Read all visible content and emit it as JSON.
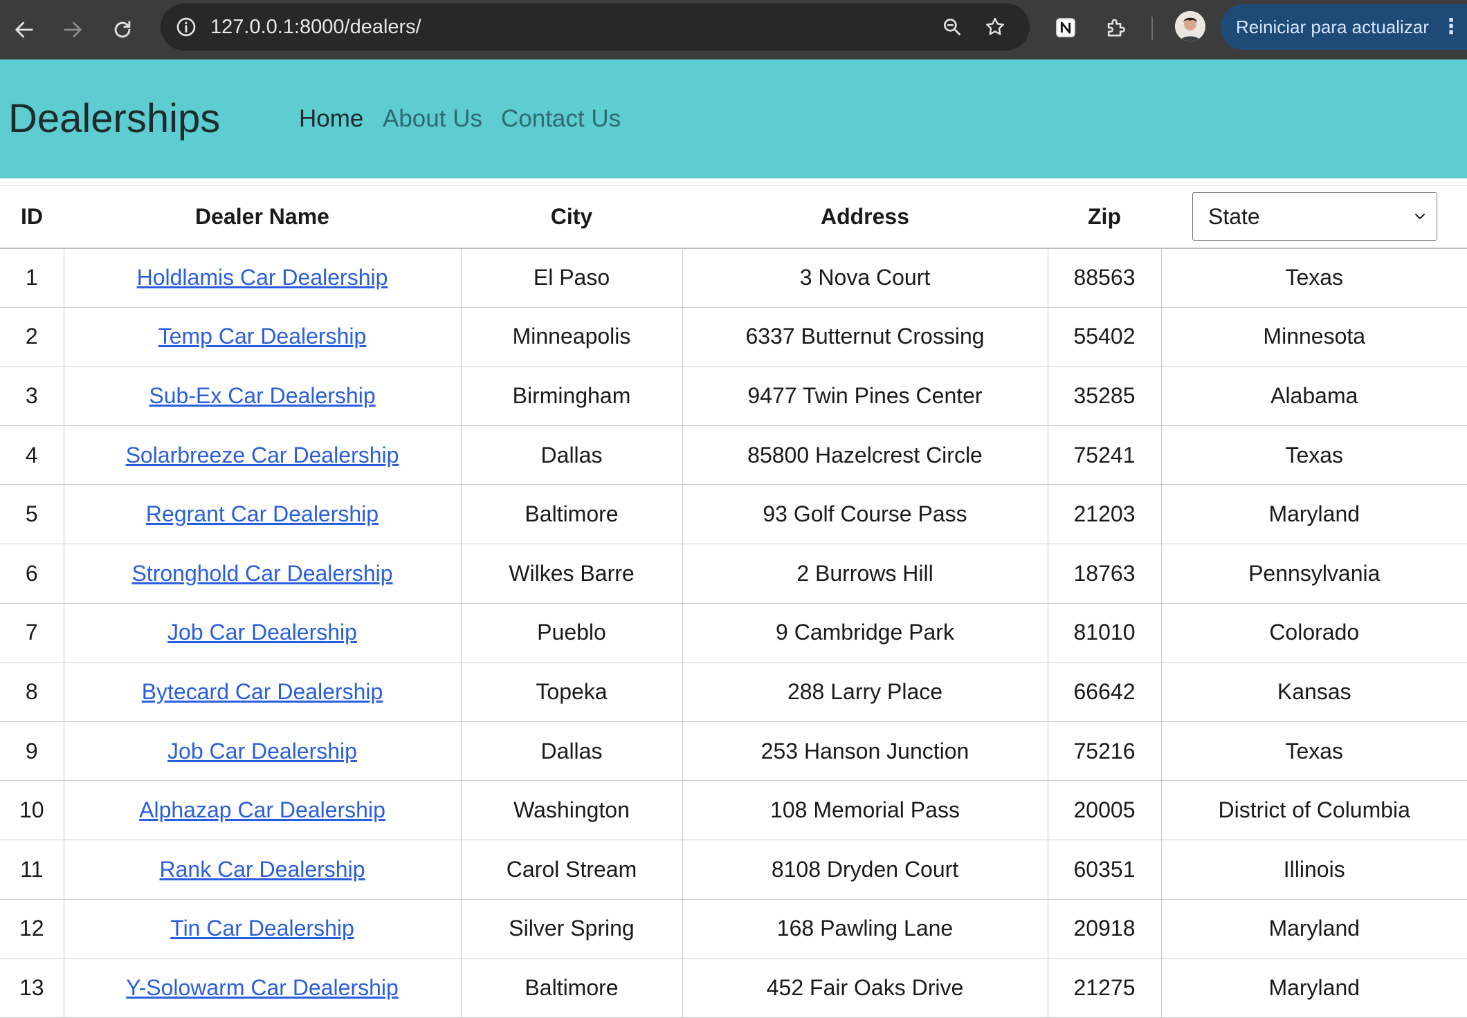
{
  "browser": {
    "url": "127.0.0.1:8000/dealers/",
    "update_button": "Reiniciar para actualizar"
  },
  "site": {
    "brand": "Dealerships",
    "nav": {
      "home": "Home",
      "about": "About Us",
      "contact": "Contact Us"
    }
  },
  "table": {
    "headers": {
      "id": "ID",
      "dealer_name": "Dealer Name",
      "city": "City",
      "address": "Address",
      "zip": "Zip"
    },
    "state_filter": {
      "selected": "State"
    },
    "rows": [
      {
        "id": "1",
        "name": "Holdlamis Car Dealership",
        "city": "El Paso",
        "address": "3 Nova Court",
        "zip": "88563",
        "state": "Texas"
      },
      {
        "id": "2",
        "name": "Temp Car Dealership",
        "city": "Minneapolis",
        "address": "6337 Butternut Crossing",
        "zip": "55402",
        "state": "Minnesota"
      },
      {
        "id": "3",
        "name": "Sub-Ex Car Dealership",
        "city": "Birmingham",
        "address": "9477 Twin Pines Center",
        "zip": "35285",
        "state": "Alabama"
      },
      {
        "id": "4",
        "name": "Solarbreeze Car Dealership",
        "city": "Dallas",
        "address": "85800 Hazelcrest Circle",
        "zip": "75241",
        "state": "Texas"
      },
      {
        "id": "5",
        "name": "Regrant Car Dealership",
        "city": "Baltimore",
        "address": "93 Golf Course Pass",
        "zip": "21203",
        "state": "Maryland"
      },
      {
        "id": "6",
        "name": "Stronghold Car Dealership",
        "city": "Wilkes Barre",
        "address": "2 Burrows Hill",
        "zip": "18763",
        "state": "Pennsylvania"
      },
      {
        "id": "7",
        "name": "Job Car Dealership",
        "city": "Pueblo",
        "address": "9 Cambridge Park",
        "zip": "81010",
        "state": "Colorado"
      },
      {
        "id": "8",
        "name": "Bytecard Car Dealership",
        "city": "Topeka",
        "address": "288 Larry Place",
        "zip": "66642",
        "state": "Kansas"
      },
      {
        "id": "9",
        "name": "Job Car Dealership",
        "city": "Dallas",
        "address": "253 Hanson Junction",
        "zip": "75216",
        "state": "Texas"
      },
      {
        "id": "10",
        "name": "Alphazap Car Dealership",
        "city": "Washington",
        "address": "108 Memorial Pass",
        "zip": "20005",
        "state": "District of Columbia"
      },
      {
        "id": "11",
        "name": "Rank Car Dealership",
        "city": "Carol Stream",
        "address": "8108 Dryden Court",
        "zip": "60351",
        "state": "Illinois"
      },
      {
        "id": "12",
        "name": "Tin Car Dealership",
        "city": "Silver Spring",
        "address": "168 Pawling Lane",
        "zip": "20918",
        "state": "Maryland"
      },
      {
        "id": "13",
        "name": "Y-Solowarm Car Dealership",
        "city": "Baltimore",
        "address": "452 Fair Oaks Drive",
        "zip": "21275",
        "state": "Maryland"
      }
    ]
  },
  "colors": {
    "chrome_bg": "#3c3c3c",
    "header_bg": "#5ecdd2",
    "link": "#2a5ee0",
    "update_pill": "#1e4a78"
  },
  "icons": [
    "back-arrow-icon",
    "forward-arrow-icon",
    "reload-icon",
    "site-info-icon",
    "zoom-icon",
    "bookmark-star-icon",
    "notion-extension-icon",
    "extensions-puzzle-icon",
    "profile-avatar",
    "more-dots-icon",
    "chevron-down-icon"
  ]
}
